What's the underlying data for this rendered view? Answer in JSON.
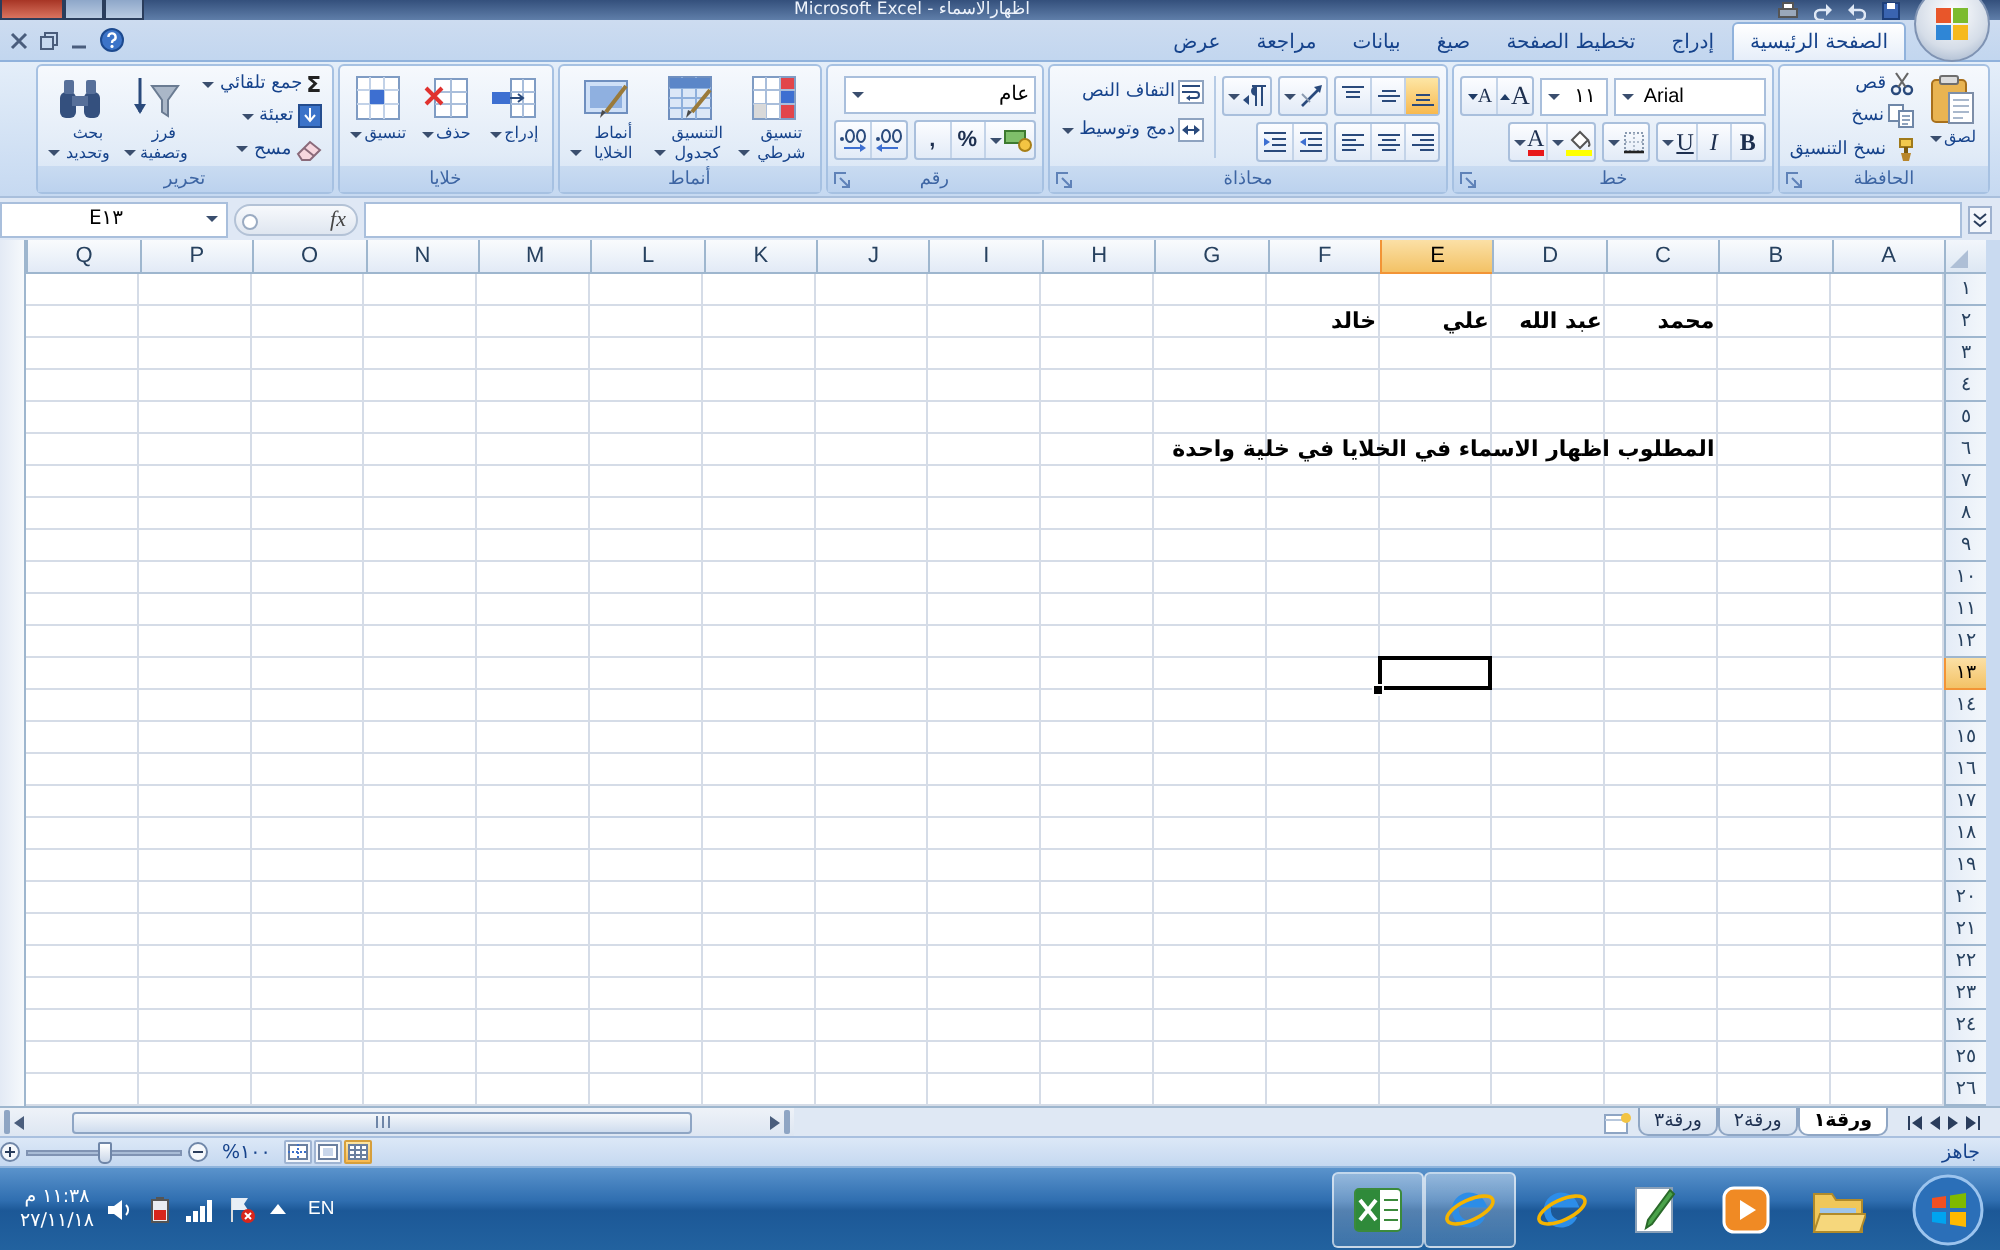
{
  "window": {
    "title": "اظهارالاسماء - Microsoft Excel"
  },
  "ribbon": {
    "tabs": [
      {
        "label": "الصفحة الرئيسية",
        "selected": true
      },
      {
        "label": "إدراج",
        "selected": false
      },
      {
        "label": "تخطيط الصفحة",
        "selected": false
      },
      {
        "label": "صيغ",
        "selected": false
      },
      {
        "label": "بيانات",
        "selected": false
      },
      {
        "label": "مراجعة",
        "selected": false
      },
      {
        "label": "عرض",
        "selected": false
      }
    ],
    "groups": [
      {
        "kind": "clipboard",
        "title": "الحافظة",
        "paste": "لصق",
        "commands": [
          {
            "kind": "cut",
            "label": "قص"
          },
          {
            "kind": "copy",
            "label": "نسخ"
          },
          {
            "kind": "format_painter",
            "label": "نسخ التنسيق"
          }
        ]
      },
      {
        "kind": "font",
        "title": "خط",
        "font_name": "Arial",
        "font_size": "١١",
        "size_buttons": [
          {
            "kind": "grow",
            "label": "A"
          },
          {
            "kind": "shrink",
            "label": "A"
          }
        ],
        "style_buttons": [
          {
            "kind": "bold",
            "label": "B"
          },
          {
            "kind": "italic",
            "label": "I"
          },
          {
            "kind": "underline",
            "label": "U"
          }
        ],
        "font_color_button": "A"
      },
      {
        "kind": "alignment",
        "title": "محاذاة",
        "vertical_align": [
          {
            "kind": "bottom",
            "selected": true
          },
          {
            "kind": "middle",
            "selected": false
          },
          {
            "kind": "top",
            "selected": false
          }
        ],
        "horizontal_align": [
          {
            "kind": "right",
            "selected": false
          },
          {
            "kind": "center",
            "selected": false
          },
          {
            "kind": "left",
            "selected": false
          }
        ],
        "commands": [
          {
            "kind": "wrap",
            "label": "التفاف النص"
          },
          {
            "kind": "merge",
            "label": "دمج وتوسيط"
          }
        ]
      },
      {
        "kind": "number",
        "title": "رقم",
        "format": "عام",
        "buttons": [
          {
            "kind": "currency"
          },
          {
            "kind": "percent",
            "label": "%"
          },
          {
            "kind": "comma",
            "label": ","
          },
          {
            "kind": "increase_decimal"
          },
          {
            "kind": "decrease_decimal"
          }
        ]
      },
      {
        "kind": "styles",
        "title": "أنماط",
        "commands": [
          {
            "kind": "conditional",
            "label": "تنسيق شرطي"
          },
          {
            "kind": "table",
            "label": "التنسيق كجدول"
          },
          {
            "kind": "cell_styles",
            "label": "أنماط الخلايا"
          }
        ]
      },
      {
        "kind": "cells",
        "title": "خلايا",
        "commands": [
          {
            "kind": "insert",
            "label": "إدراج"
          },
          {
            "kind": "delete",
            "label": "حذف"
          },
          {
            "kind": "format",
            "label": "تنسيق"
          }
        ]
      },
      {
        "kind": "editing",
        "title": "تحرير",
        "small_commands": [
          {
            "kind": "autosum",
            "icon": "Σ",
            "label": "جمع تلقائي"
          },
          {
            "kind": "fill",
            "label": "تعبئة"
          },
          {
            "kind": "clear",
            "label": "مسح"
          }
        ],
        "big_commands": [
          {
            "kind": "sort",
            "label": "فرز وتصفية"
          },
          {
            "kind": "find",
            "label": "بحث وتحديد"
          }
        ]
      }
    ]
  },
  "formula_bar": {
    "name_box": "E١٣",
    "function_button": "fx"
  },
  "sheet": {
    "columns": [
      {
        "label": "A",
        "selected": false
      },
      {
        "label": "B",
        "selected": false
      },
      {
        "label": "C",
        "selected": false
      },
      {
        "label": "D",
        "selected": false
      },
      {
        "label": "E",
        "selected": true
      },
      {
        "label": "F",
        "selected": false
      },
      {
        "label": "G",
        "selected": false
      },
      {
        "label": "H",
        "selected": false
      },
      {
        "label": "I",
        "selected": false
      },
      {
        "label": "J",
        "selected": false
      },
      {
        "label": "K",
        "selected": false
      },
      {
        "label": "L",
        "selected": false
      },
      {
        "label": "M",
        "selected": false
      },
      {
        "label": "N",
        "selected": false
      },
      {
        "label": "O",
        "selected": false
      },
      {
        "label": "P",
        "selected": false
      },
      {
        "label": "Q",
        "selected": false
      }
    ],
    "rows": [
      {
        "label": "١",
        "selected": false
      },
      {
        "label": "٢",
        "selected": false,
        "cells": [
          null,
          null,
          "محمد",
          "عبد الله",
          "علي",
          "خالد"
        ]
      },
      {
        "label": "٣",
        "selected": false
      },
      {
        "label": "٤",
        "selected": false
      },
      {
        "label": "٥",
        "selected": false
      },
      {
        "label": "٦",
        "selected": false,
        "cells": [
          null,
          null,
          "المطلوب اظهار الاسماء في الخلايا في خلية واحدة"
        ]
      },
      {
        "label": "٧",
        "selected": false
      },
      {
        "label": "٨",
        "selected": false
      },
      {
        "label": "٩",
        "selected": false
      },
      {
        "label": "١٠",
        "selected": false
      },
      {
        "label": "١١",
        "selected": false
      },
      {
        "label": "١٢",
        "selected": false
      },
      {
        "label": "١٣",
        "selected": true
      },
      {
        "label": "١٤",
        "selected": false
      },
      {
        "label": "١٥",
        "selected": false
      },
      {
        "label": "١٦",
        "selected": false
      },
      {
        "label": "١٧",
        "selected": false
      },
      {
        "label": "١٨",
        "selected": false
      },
      {
        "label": "١٩",
        "selected": false
      },
      {
        "label": "٢٠",
        "selected": false
      },
      {
        "label": "٢١",
        "selected": false
      },
      {
        "label": "٢٢",
        "selected": false
      },
      {
        "label": "٢٣",
        "selected": false
      },
      {
        "label": "٢٤",
        "selected": false
      },
      {
        "label": "٢٥",
        "selected": false
      },
      {
        "label": "٢٦",
        "selected": false
      }
    ]
  },
  "sheet_tabs": [
    {
      "label": "ورقة١",
      "selected": true
    },
    {
      "label": "ورقة٢",
      "selected": false
    },
    {
      "label": "ورقة٣",
      "selected": false
    }
  ],
  "status_bar": {
    "status": "جاهز",
    "views": [
      {
        "kind": "normal",
        "selected": true
      },
      {
        "kind": "page_layout",
        "selected": false
      },
      {
        "kind": "page_break",
        "selected": false
      }
    ],
    "zoom": "١٠٠%",
    "zoom_slider": {
      "level": 0.5
    }
  },
  "taskbar": {
    "apps": [
      {
        "kind": "explorer",
        "running": false
      },
      {
        "kind": "media",
        "running": false
      },
      {
        "kind": "paint",
        "running": false
      },
      {
        "kind": "browser",
        "running": false
      },
      {
        "kind": "browser",
        "running": true
      },
      {
        "kind": "excel",
        "running": true
      }
    ],
    "language": "EN",
    "time": "١١:٣٨ م",
    "date": "٢٧/١١/١٨"
  }
}
